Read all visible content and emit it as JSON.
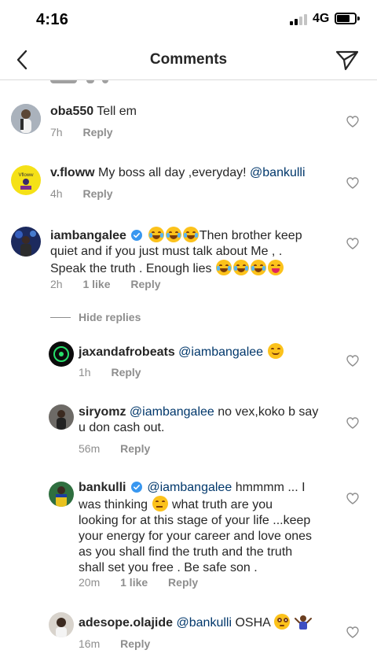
{
  "status_bar": {
    "time": "4:16",
    "network": "4G"
  },
  "nav": {
    "title": "Comments"
  },
  "comments": [
    {
      "user": "oba550",
      "text": "Tell em",
      "time": "7h",
      "reply": "Reply"
    },
    {
      "user": "v.floww",
      "text_before": "My boss all day ,everyday!",
      "mention": "@bankulli",
      "time": "4h",
      "reply": "Reply"
    },
    {
      "user": "iambangalee",
      "line1": "Then brother keep",
      "line2": "quiet  and if you just must talk about Me , .",
      "line3": "Speak the truth . Enough lies",
      "time": "2h",
      "likes": "1 like",
      "reply": "Reply"
    }
  ],
  "hide_replies": "Hide replies",
  "replies": [
    {
      "user": "jaxandafrobeats",
      "mention": "@iambangalee",
      "time": "1h",
      "reply": "Reply"
    },
    {
      "user": "siryomz",
      "mention": "@iambangalee",
      "line1": "no vex,koko b say",
      "line2": "u don cash out.",
      "time": "56m",
      "reply": "Reply"
    },
    {
      "user": "bankulli",
      "mention": "@iambangalee",
      "line1": "hmmmm ... I",
      "line2a": "was thinking",
      "line2b": "what truth are you",
      "line3": "looking for at this stage of your life ...keep",
      "line4": "your energy for your career and love ones",
      "line5": "as you shall find the truth and the truth",
      "line6": "shall set you free . Be safe son .",
      "time": "20m",
      "likes": "1 like",
      "reply": "Reply"
    },
    {
      "user": "adesope.olajide",
      "mention": "@bankulli",
      "text": "OSHA",
      "time": "16m",
      "reply": "Reply"
    }
  ],
  "colors": {
    "text": "#262626",
    "meta": "#8e8e8e",
    "mention": "#00376b",
    "verified": "#3897f0",
    "divider": "#dbdbdb"
  },
  "icons": [
    "back-arrow-icon",
    "send-icon",
    "heart-icon",
    "verified-badge-icon",
    "signal-icon",
    "battery-icon"
  ]
}
